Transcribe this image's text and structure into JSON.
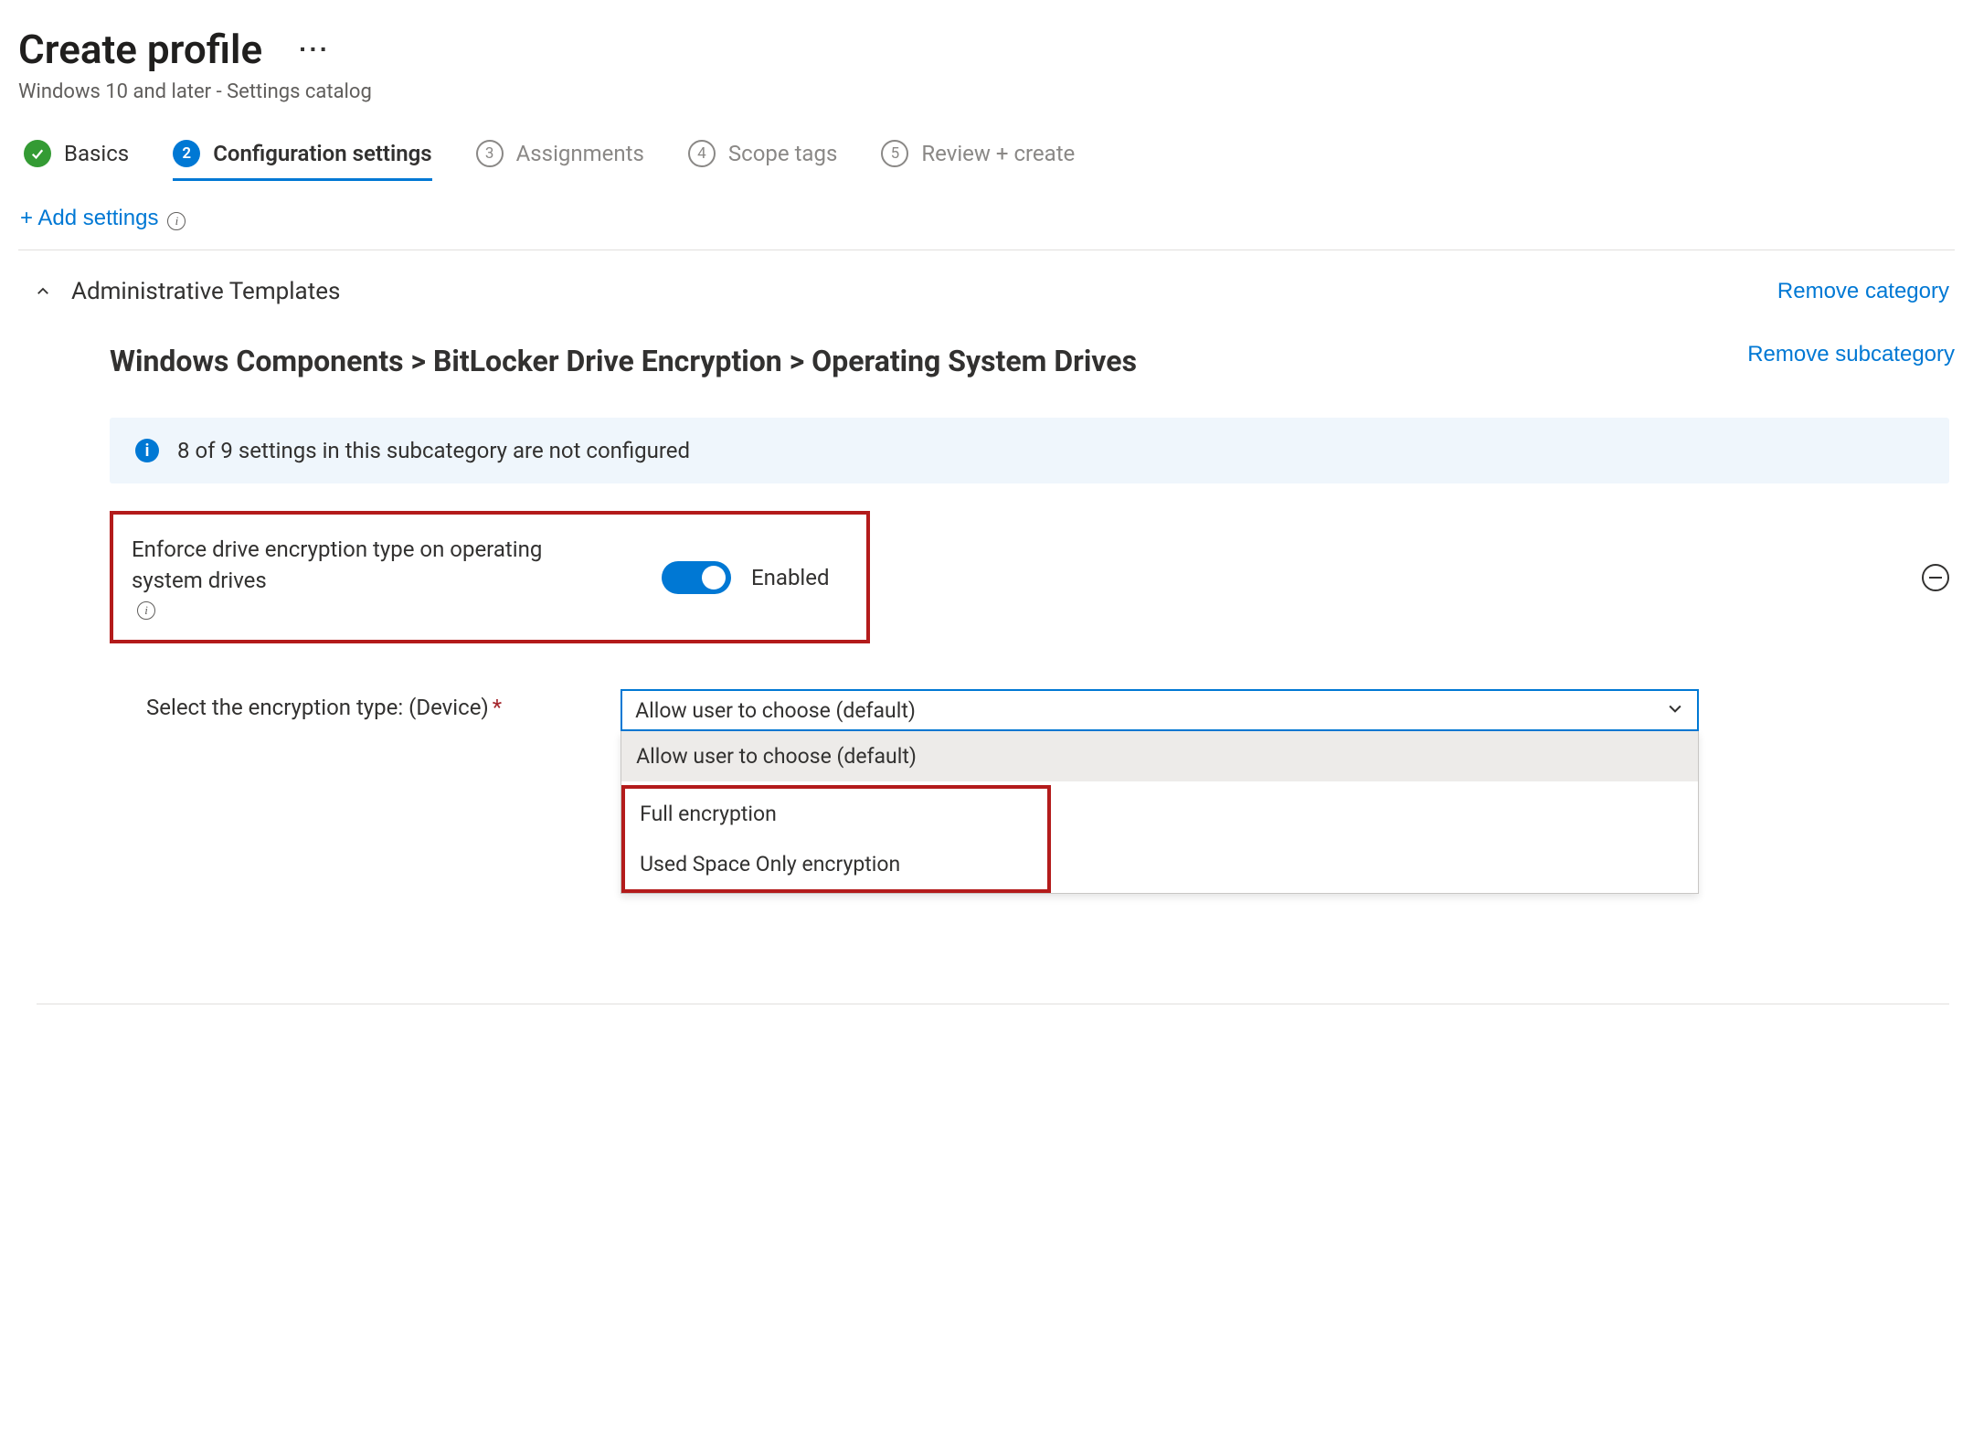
{
  "header": {
    "title": "Create profile",
    "subtitle": "Windows 10 and later - Settings catalog"
  },
  "stepper": {
    "steps": [
      {
        "num": "",
        "label": "Basics",
        "state": "done"
      },
      {
        "num": "2",
        "label": "Configuration settings",
        "state": "current"
      },
      {
        "num": "3",
        "label": "Assignments",
        "state": "upcoming"
      },
      {
        "num": "4",
        "label": "Scope tags",
        "state": "upcoming"
      },
      {
        "num": "5",
        "label": "Review + create",
        "state": "upcoming"
      }
    ]
  },
  "actions": {
    "add_settings": "+ Add settings"
  },
  "category": {
    "title": "Administrative Templates",
    "remove_label": "Remove category"
  },
  "subcategory": {
    "title": "Windows Components > BitLocker Drive Encryption > Operating System Drives",
    "remove_label": "Remove subcategory"
  },
  "notice": {
    "text": "8 of 9 settings in this subcategory are not configured"
  },
  "setting": {
    "label": "Enforce drive encryption type on operating system drives",
    "toggle_state": "Enabled"
  },
  "dropdown": {
    "label": "Select the encryption type: (Device)",
    "selected": "Allow user to choose (default)",
    "options": [
      "Allow user to choose (default)",
      "Full encryption",
      "Used Space Only encryption"
    ]
  }
}
